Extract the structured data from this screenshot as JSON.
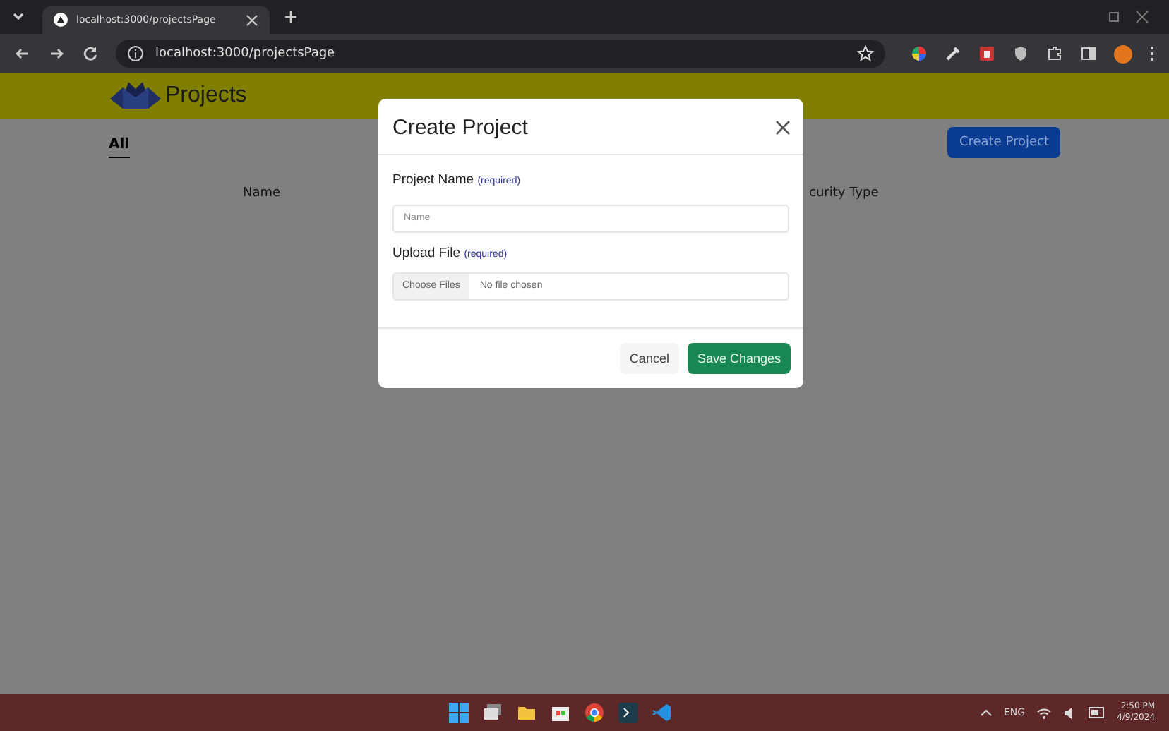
{
  "browser": {
    "tab_title": "localhost:3000/projectsPage",
    "url": "localhost:3000/projectsPage"
  },
  "header": {
    "title": "Projects"
  },
  "tabs": [
    {
      "label": "All",
      "selected": true
    }
  ],
  "create_button": "Create Project",
  "table": {
    "columns": [
      "Name",
      "curity Type"
    ]
  },
  "modal": {
    "title": "Create Project",
    "fields": [
      {
        "kind": "text",
        "label": "Project Name",
        "required": "(required)",
        "placeholder": "Name"
      },
      {
        "kind": "file",
        "label": "Upload File",
        "required": "(required)",
        "button": "Choose Files",
        "value": "No file chosen"
      }
    ],
    "buttons": [
      {
        "label": "Cancel",
        "kind": "secondary"
      },
      {
        "label": "Save Changes",
        "kind": "primary"
      }
    ]
  },
  "taskbar": {
    "language": "ENG",
    "time": "2:50 PM",
    "date": "4/9/2024"
  }
}
